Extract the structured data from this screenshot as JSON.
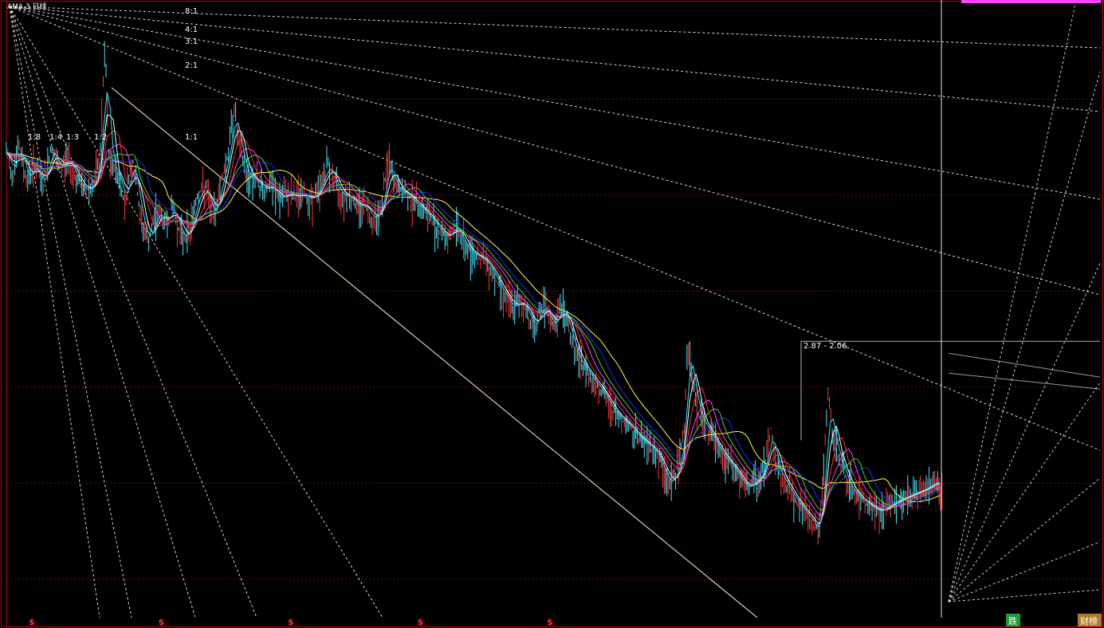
{
  "header": {
    "corner_label": "AMA 3 日线"
  },
  "chart_data": {
    "type": "line",
    "title": "",
    "xlabel": "",
    "ylabel": "",
    "grid": true,
    "x_range": [
      0,
      1000
    ],
    "y_range": [
      1.2,
      8.0
    ],
    "price_points": [
      [
        0,
        5.4
      ],
      [
        6,
        5.0
      ],
      [
        12,
        5.55
      ],
      [
        20,
        4.9
      ],
      [
        28,
        5.2
      ],
      [
        36,
        4.8
      ],
      [
        44,
        5.5
      ],
      [
        52,
        5.1
      ],
      [
        60,
        5.3
      ],
      [
        70,
        4.9
      ],
      [
        78,
        4.75
      ],
      [
        86,
        4.85
      ],
      [
        92,
        5.3
      ],
      [
        97,
        7.6
      ],
      [
        101,
        5.2
      ],
      [
        108,
        5.1
      ],
      [
        116,
        4.55
      ],
      [
        124,
        5.3
      ],
      [
        132,
        4.3
      ],
      [
        140,
        4.0
      ],
      [
        148,
        4.45
      ],
      [
        156,
        4.25
      ],
      [
        164,
        4.5
      ],
      [
        172,
        4.05
      ],
      [
        180,
        4.15
      ],
      [
        188,
        4.7
      ],
      [
        196,
        4.8
      ],
      [
        204,
        4.3
      ],
      [
        212,
        5.0
      ],
      [
        218,
        5.35
      ],
      [
        224,
        6.3
      ],
      [
        228,
        5.6
      ],
      [
        236,
        5.0
      ],
      [
        244,
        4.95
      ],
      [
        252,
        4.75
      ],
      [
        260,
        4.85
      ],
      [
        268,
        4.6
      ],
      [
        276,
        4.72
      ],
      [
        284,
        4.65
      ],
      [
        292,
        4.7
      ],
      [
        300,
        4.6
      ],
      [
        308,
        4.8
      ],
      [
        316,
        5.2
      ],
      [
        324,
        4.85
      ],
      [
        330,
        4.65
      ],
      [
        336,
        4.7
      ],
      [
        344,
        4.5
      ],
      [
        352,
        4.55
      ],
      [
        360,
        4.3
      ],
      [
        368,
        4.45
      ],
      [
        376,
        5.3
      ],
      [
        380,
        4.9
      ],
      [
        386,
        4.75
      ],
      [
        394,
        4.7
      ],
      [
        402,
        4.55
      ],
      [
        410,
        4.45
      ],
      [
        418,
        4.3
      ],
      [
        426,
        4.15
      ],
      [
        434,
        4.05
      ],
      [
        442,
        4.25
      ],
      [
        450,
        3.95
      ],
      [
        458,
        3.85
      ],
      [
        466,
        3.8
      ],
      [
        474,
        3.7
      ],
      [
        482,
        3.5
      ],
      [
        490,
        3.35
      ],
      [
        498,
        3.2
      ],
      [
        506,
        3.3
      ],
      [
        514,
        3.1
      ],
      [
        520,
        3.0
      ],
      [
        526,
        3.25
      ],
      [
        532,
        3.15
      ],
      [
        538,
        3.0
      ],
      [
        546,
        3.25
      ],
      [
        554,
        2.95
      ],
      [
        562,
        2.7
      ],
      [
        570,
        2.6
      ],
      [
        578,
        2.5
      ],
      [
        586,
        2.42
      ],
      [
        594,
        2.3
      ],
      [
        602,
        2.22
      ],
      [
        610,
        2.18
      ],
      [
        618,
        2.1
      ],
      [
        626,
        2.05
      ],
      [
        632,
        2.02
      ],
      [
        638,
        1.98
      ],
      [
        644,
        1.9
      ],
      [
        648,
        1.82
      ],
      [
        654,
        1.78
      ],
      [
        660,
        1.88
      ],
      [
        666,
        2.1
      ],
      [
        670,
        2.87
      ],
      [
        674,
        2.55
      ],
      [
        680,
        2.25
      ],
      [
        688,
        2.15
      ],
      [
        696,
        2.05
      ],
      [
        704,
        1.95
      ],
      [
        712,
        1.9
      ],
      [
        720,
        1.82
      ],
      [
        728,
        1.75
      ],
      [
        736,
        1.8
      ],
      [
        744,
        1.85
      ],
      [
        752,
        2.15
      ],
      [
        756,
        1.9
      ],
      [
        764,
        1.8
      ],
      [
        772,
        1.72
      ],
      [
        780,
        1.65
      ],
      [
        788,
        1.6
      ],
      [
        794,
        1.55
      ],
      [
        798,
        1.52
      ],
      [
        802,
        1.68
      ],
      [
        808,
        2.4
      ],
      [
        812,
        2.1
      ],
      [
        818,
        1.95
      ],
      [
        826,
        1.8
      ],
      [
        834,
        1.72
      ],
      [
        842,
        1.68
      ],
      [
        850,
        1.65
      ],
      [
        858,
        1.62
      ],
      [
        866,
        1.65
      ],
      [
        874,
        1.68
      ],
      [
        882,
        1.7
      ],
      [
        890,
        1.72
      ],
      [
        898,
        1.74
      ],
      [
        906,
        1.76
      ],
      [
        914,
        1.8
      ],
      [
        920,
        1.75
      ]
    ],
    "moving_averages": [
      {
        "color": "#ffff40",
        "lag": 60
      },
      {
        "color": "#2828ff",
        "lag": 42
      },
      {
        "color": "#30e030",
        "lag": 32
      },
      {
        "color": "#ff40ff",
        "lag": 24
      },
      {
        "color": "#ff3030",
        "lag": 16
      },
      {
        "color": "#ffffff",
        "lag": 10
      },
      {
        "color": "#30e0ff",
        "lag": 6
      }
    ],
    "gann_fan_labels": [
      "8:1",
      "4:1",
      "3:1",
      "2:1",
      "1:1",
      "1:2",
      "1:3",
      "1:4",
      "1:8"
    ],
    "annotation": {
      "text": "2.87 - 2.06",
      "high": 2.87,
      "low": 2.06
    },
    "event_markers": {
      "symbol": "$",
      "count": 5
    },
    "badges": [
      {
        "text": "跌",
        "color": "#1f9a3a"
      },
      {
        "text": "财榜",
        "color": "#b07a2a"
      }
    ],
    "colors": {
      "background": "#000000",
      "grid": "#9a0000",
      "border": "#c00000",
      "fan": "#ffffff",
      "candle_up": "#ff3a3a",
      "candle_down": "#40e8ff",
      "crosshair": "#ffffff",
      "top_bar": "#ff40ff"
    }
  }
}
